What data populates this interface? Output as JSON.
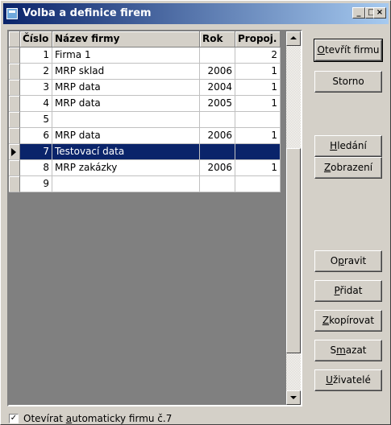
{
  "window": {
    "title": "Volba a definice firem",
    "min_glyph": "_",
    "max_glyph": "□",
    "close_glyph": "×"
  },
  "grid": {
    "columns": [
      "Číslo",
      "Název firmy",
      "Rok",
      "Propoj."
    ],
    "rows": [
      {
        "num": "1",
        "name": "Firma 1",
        "rok": "",
        "prop": "2"
      },
      {
        "num": "2",
        "name": "MRP sklad",
        "rok": "2006",
        "prop": "1"
      },
      {
        "num": "3",
        "name": "MRP data",
        "rok": "2004",
        "prop": "1"
      },
      {
        "num": "4",
        "name": "MRP data",
        "rok": "2005",
        "prop": "1"
      },
      {
        "num": "5",
        "name": "",
        "rok": "",
        "prop": ""
      },
      {
        "num": "6",
        "name": "MRP data",
        "rok": "2006",
        "prop": "1"
      },
      {
        "num": "7",
        "name": "Testovací data",
        "rok": "",
        "prop": "",
        "selected": true
      },
      {
        "num": "8",
        "name": "MRP zakázky",
        "rok": "2006",
        "prop": "1"
      },
      {
        "num": "9",
        "name": "",
        "rok": "",
        "prop": ""
      }
    ]
  },
  "buttons": {
    "open": {
      "accel": "O",
      "rest": "tevřít firmu"
    },
    "cancel": {
      "label": "Storno"
    },
    "search": {
      "accel": "H",
      "rest": "ledání"
    },
    "view": {
      "accel": "Z",
      "rest": "obrazení"
    },
    "edit": {
      "pre": "O",
      "accel": "p",
      "rest": "ravit"
    },
    "add": {
      "accel": "P",
      "rest": "řidat"
    },
    "copy": {
      "accel": "Z",
      "rest": "kopírovat"
    },
    "delete": {
      "pre": "S",
      "accel": "m",
      "rest": "azat"
    },
    "users": {
      "accel": "U",
      "rest": "živatelé"
    }
  },
  "auto_open": {
    "checked": true,
    "check_glyph": "✓",
    "pre": "Otevírat ",
    "accel": "a",
    "rest": "utomaticky firmu č.7"
  },
  "colors": {
    "face": "#d4d0c8",
    "selection": "#0a246a",
    "title_start": "#0a246a",
    "title_end": "#a6caf0"
  }
}
